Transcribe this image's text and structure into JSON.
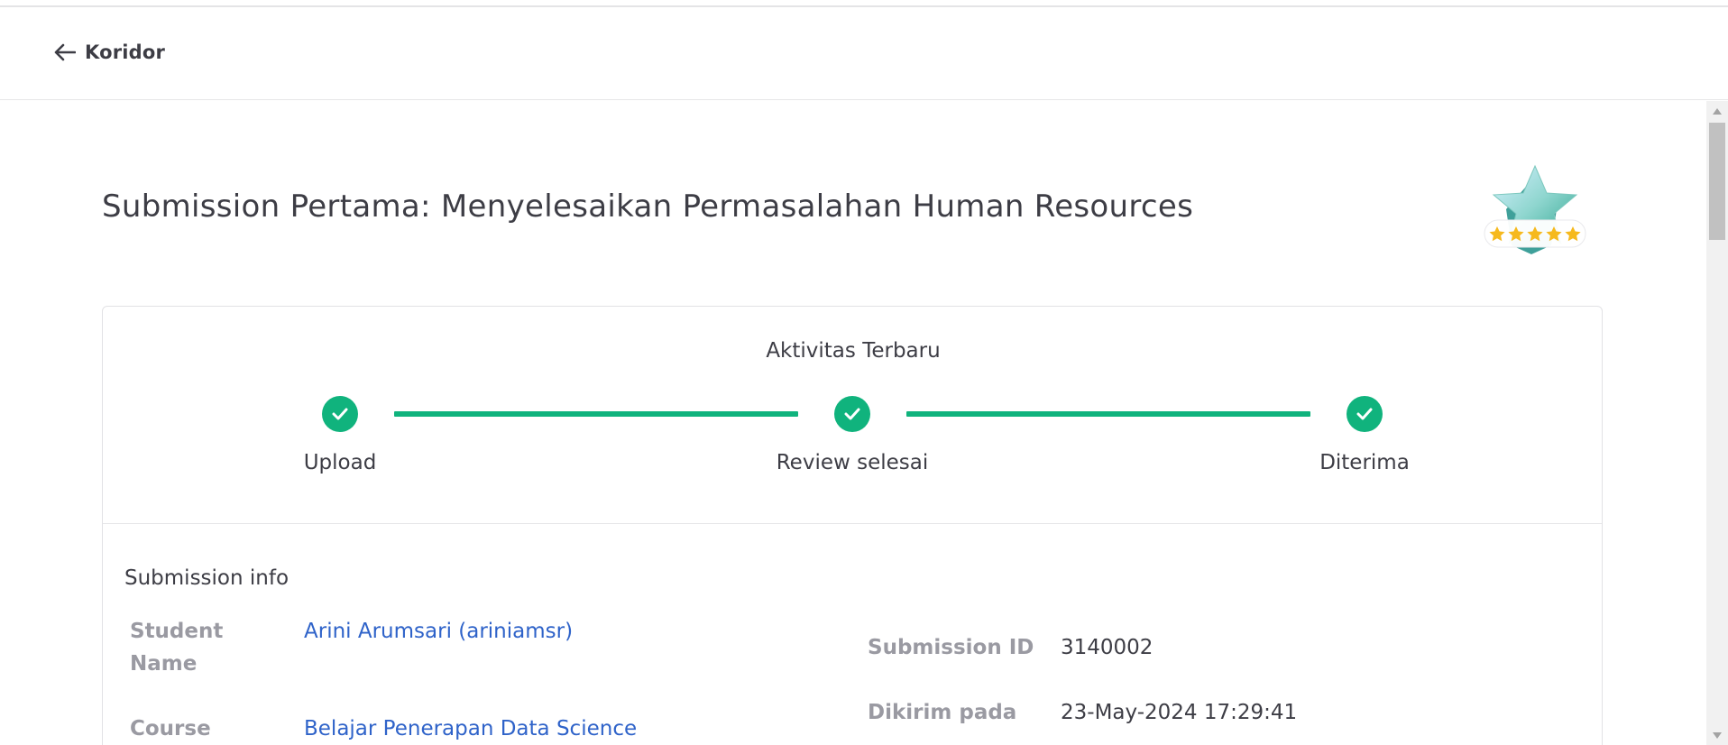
{
  "header": {
    "back_label": "Koridor"
  },
  "page": {
    "title": "Submission Pertama: Menyelesaikan Permasalahan Human Resources"
  },
  "badge": {
    "rating_stars": 5,
    "icon": "star-badge-icon",
    "colors": {
      "star": "#f6b91d",
      "badge": "#5fc7b4"
    }
  },
  "activity": {
    "heading": "Aktivitas Terbaru",
    "accent_color": "#10b37d",
    "steps": [
      {
        "label": "Upload",
        "status": "done"
      },
      {
        "label": "Review selesai",
        "status": "done"
      },
      {
        "label": "Diterima",
        "status": "done"
      }
    ]
  },
  "submission_info": {
    "title": "Submission info",
    "student_name_label": "Student Name",
    "student_name_value": "Arini Arumsari (ariniamsr)",
    "course_label": "Course",
    "course_value": "Belajar Penerapan Data Science",
    "submission_id_label": "Submission ID",
    "submission_id_value": "3140002",
    "sent_at_label": "Dikirim pada",
    "sent_at_value": "23-May-2024 17:29:41"
  },
  "colors": {
    "link": "#2f63c9",
    "label_gray": "#9a9aa2",
    "text": "#3d3d45"
  }
}
